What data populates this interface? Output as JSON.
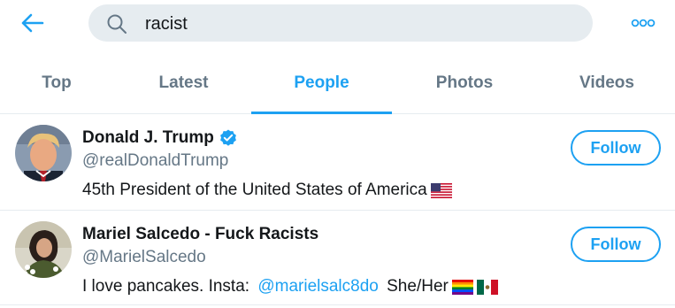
{
  "search": {
    "query": "racist"
  },
  "tabs": [
    {
      "label": "Top"
    },
    {
      "label": "Latest"
    },
    {
      "label": "People"
    },
    {
      "label": "Photos"
    },
    {
      "label": "Videos"
    }
  ],
  "active_tab": "People",
  "results": [
    {
      "name": "Donald J. Trump",
      "handle": "@realDonaldTrump",
      "bio": "45th President of the United States of America",
      "verified": true,
      "follow_label": "Follow",
      "bio_emoji": [
        "us-flag"
      ]
    },
    {
      "name": "Mariel Salcedo - Fuck Racists",
      "handle": "@MarielSalcedo",
      "bio_prefix": "I love pancakes. Insta: ",
      "bio_mention": "@marielsalc8do",
      "bio_suffix": " She/Her",
      "verified": false,
      "follow_label": "Follow",
      "bio_emoji": [
        "rainbow-flag",
        "mexico-flag"
      ]
    }
  ],
  "colors": {
    "accent": "#1da1f2",
    "secondary_text": "#657786",
    "search_bg": "#e6ecf0"
  },
  "icons": [
    "back-arrow-icon",
    "search-icon",
    "more-options-icon",
    "verified-badge-icon"
  ]
}
